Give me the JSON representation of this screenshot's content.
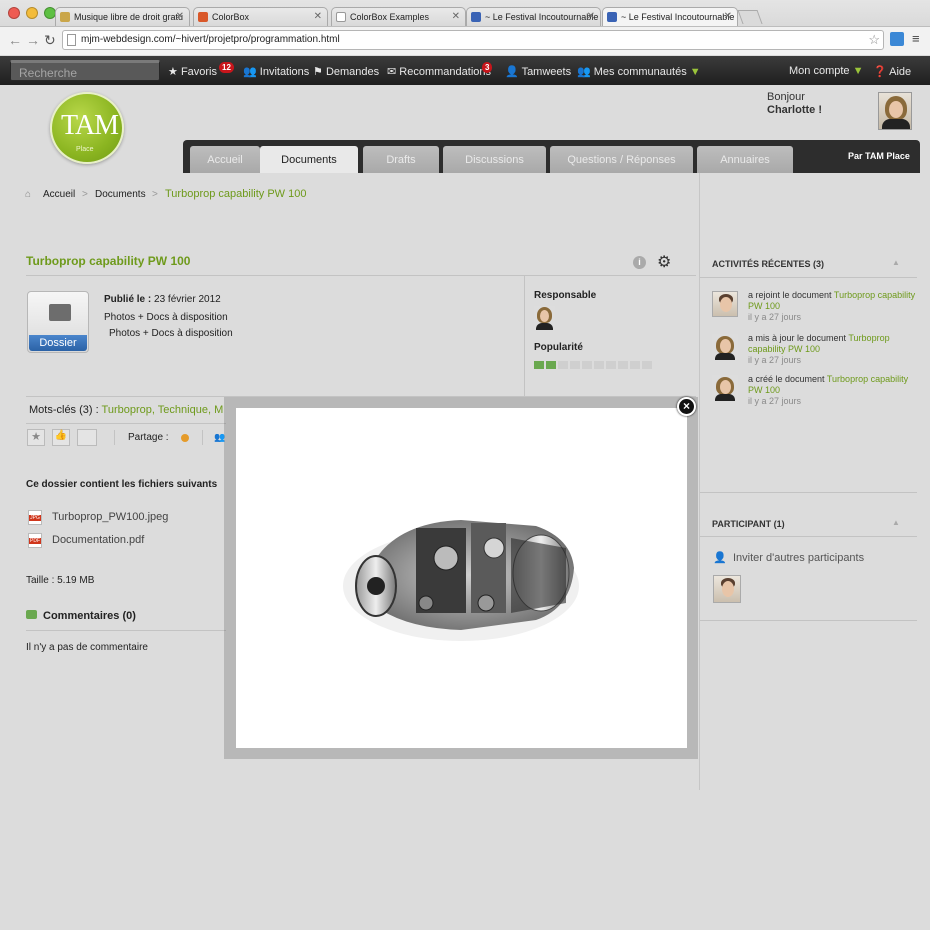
{
  "browser": {
    "tabs": [
      {
        "title": "Musique libre de droit gratu"
      },
      {
        "title": "ColorBox"
      },
      {
        "title": "ColorBox Examples"
      },
      {
        "title": "~ Le Festival Incoutournable"
      },
      {
        "title": "~ Le Festival Incoutournable"
      }
    ],
    "url": "mjm-webdesign.com/~hivert/projetpro/programmation.html"
  },
  "sitenav": {
    "search_placeholder": "Recherche",
    "items": [
      {
        "label": "Favoris",
        "badge": "12"
      },
      {
        "label": "Invitations"
      },
      {
        "label": "Demandes"
      },
      {
        "label": "Recommandations",
        "badge": "3"
      },
      {
        "label": "Tamweets"
      },
      {
        "label": "Mes communautés"
      }
    ],
    "account": "Mon compte",
    "help": "Aide"
  },
  "header": {
    "logo_text": "TAM",
    "logo_sub": "Place",
    "greeting": "Bonjour",
    "username": "Charlotte !"
  },
  "tabs": [
    "Accueil",
    "Documents",
    "Drafts",
    "Discussions",
    "Questions / Réponses",
    "Annuaires"
  ],
  "tabs_right": "Par TAM Place",
  "breadcrumb": {
    "home": "Accueil",
    "section": "Documents",
    "current": "Turboprop capability PW 100"
  },
  "document": {
    "title": "Turboprop capability PW 100",
    "folder_label": "Dossier",
    "published_label": "Publié le :",
    "published_date": "23 février 2012",
    "desc1": "Photos + Docs à disposition",
    "desc2": "Photos + Docs à disposition",
    "responsable_label": "Responsable",
    "popularity_label": "Popularité",
    "popularity": {
      "filled": 2,
      "total": 10
    },
    "keywords_label": "Mots-clés (3)",
    "keywords": "Turboprop, Technique, M",
    "share_label": "Partage :",
    "files_heading": "Ce dossier contient les fichiers suivants",
    "files": [
      {
        "type": "JPG",
        "name": "Turboprop_PW100.jpeg"
      },
      {
        "type": "PDF",
        "name": "Documentation.pdf"
      }
    ],
    "size": "Taille : 5.19 MB",
    "comments_label": "Commentaires (0)",
    "no_comment": "Il n'y a pas de commentaire"
  },
  "sidebar": {
    "activity_title": "ACTIVITÉS RÉCENTES (3)",
    "activities": [
      {
        "action": "a rejoint le document",
        "link": "Turboprop capability PW 100",
        "time": "il y a 27 jours"
      },
      {
        "action": "a mis à jour le document",
        "link": "Turboprop capability PW 100",
        "time": "il y a 27 jours"
      },
      {
        "action": "a créé le document",
        "link": "Turboprop capability PW 100",
        "time": "il y a 27 jours"
      }
    ],
    "participants_title": "PARTICIPANT (1)",
    "invite_label": "Inviter d'autres participants"
  },
  "colors": {
    "accent_green": "#6e9a1b",
    "badge_red": "#c8151b",
    "nav_dark": "#2d2d2d",
    "button_blue": "#2b62a6"
  }
}
